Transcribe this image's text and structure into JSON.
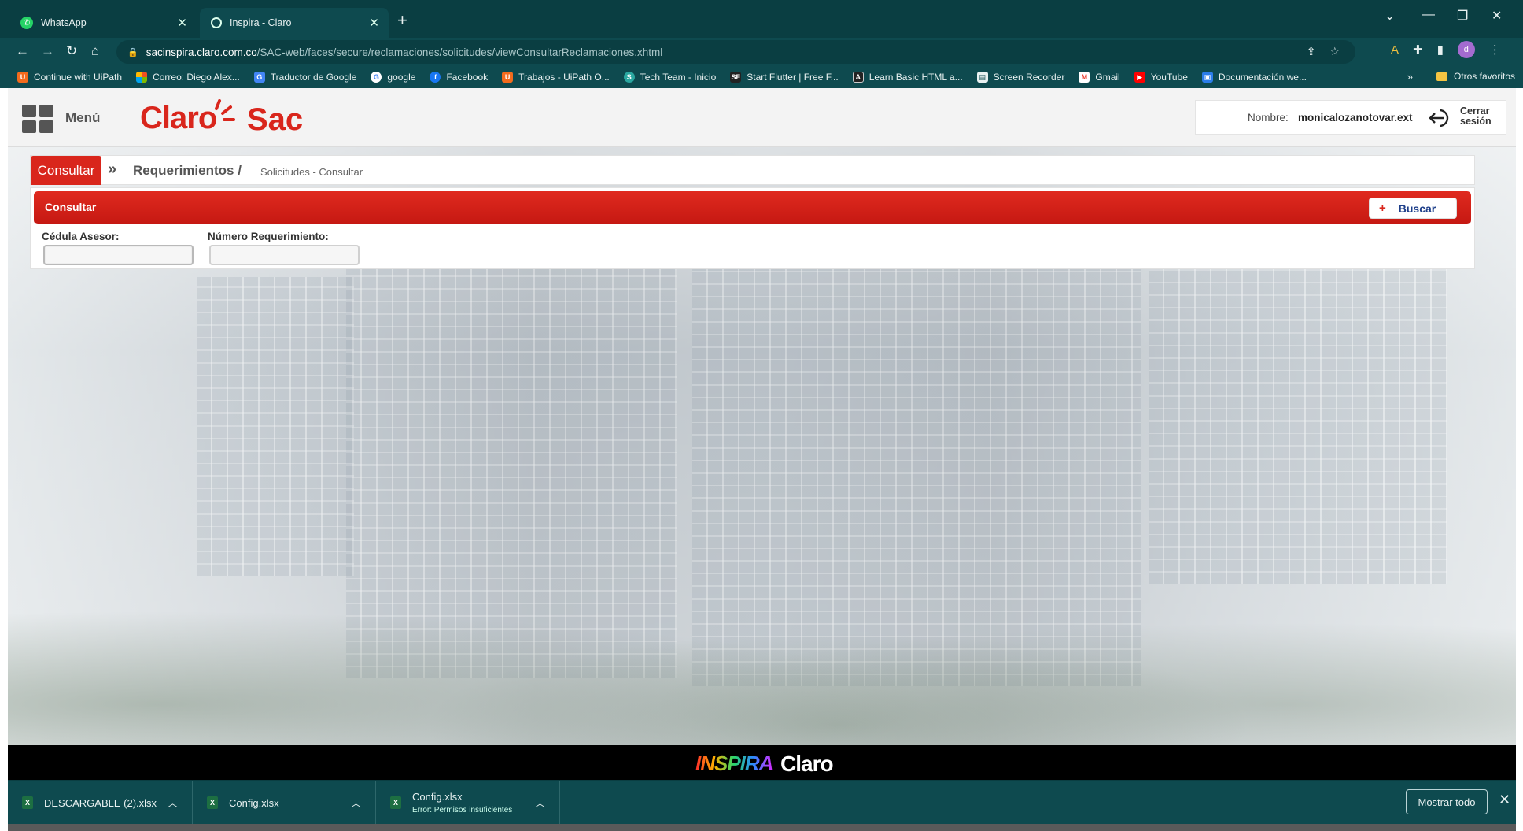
{
  "browser": {
    "tabs": [
      {
        "title": "WhatsApp",
        "icon": "whatsapp-icon"
      },
      {
        "title": "Inspira - Claro",
        "icon": "globe-icon"
      }
    ],
    "url_host": "sacinspira.claro.com.co",
    "url_path": "/SAC-web/faces/secure/reclamaciones/solicitudes/viewConsultarReclamaciones.xhtml",
    "profile_initial": "d",
    "bookmarks": [
      {
        "label": "Continue with UiPath",
        "icon": "uipath-icon",
        "color": "#f26b1d"
      },
      {
        "label": "Correo: Diego Alex...",
        "icon": "microsoft-icon",
        "color": "#f25022"
      },
      {
        "label": "Traductor de Google",
        "icon": "translate-icon",
        "color": "#4285f4"
      },
      {
        "label": "google",
        "icon": "google-icon",
        "color": "#ffffff"
      },
      {
        "label": "Facebook",
        "icon": "facebook-icon",
        "color": "#1877f2"
      },
      {
        "label": "Trabajos - UiPath O...",
        "icon": "uipath-icon",
        "color": "#f26b1d"
      },
      {
        "label": "Tech Team - Inicio",
        "icon": "techteam-icon",
        "color": "#2aa7a0"
      },
      {
        "label": "Start Flutter | Free F...",
        "icon": "sf-icon",
        "color": "#222222"
      },
      {
        "label": "Learn Basic HTML a...",
        "icon": "angular-icon",
        "color": "#222222"
      },
      {
        "label": "Screen Recorder",
        "icon": "document-icon",
        "color": "#e8f1f1"
      },
      {
        "label": "Gmail",
        "icon": "gmail-icon",
        "color": "#ea4335"
      },
      {
        "label": "YouTube",
        "icon": "youtube-icon",
        "color": "#ff0000"
      },
      {
        "label": "Documentación we...",
        "icon": "doc-web-icon",
        "color": "#2b7de9"
      }
    ],
    "bookmarks_more": "»",
    "other_bookmarks": "Otros favoritos"
  },
  "app": {
    "menu_label": "Menú",
    "logo_brand": "Claro",
    "logo_product": "Sac",
    "user_label": "Nombre:",
    "user_name": "monicalozanotovar.ext",
    "logout_label": "Cerrar sesión",
    "breadcrumb": {
      "button": "Consultar",
      "separator": "»",
      "main": "Requerimientos /",
      "sub": "Solicitudes - Consultar"
    },
    "panel": {
      "title": "Consultar",
      "search_button": "Buscar",
      "fields": [
        {
          "label": "Cédula Asesor:",
          "value": ""
        },
        {
          "label": "Número Requerimiento:",
          "value": ""
        }
      ]
    },
    "footer_brand_1": "INSPIRA",
    "footer_brand_2": "Claro",
    "accent_color": "#d9261c"
  },
  "downloads": {
    "items": [
      {
        "name": "DESCARGABLE (2).xlsx",
        "status": ""
      },
      {
        "name": "Config.xlsx",
        "status": ""
      },
      {
        "name": "Config.xlsx",
        "status": "Error: Permisos insuficientes"
      }
    ],
    "show_all": "Mostrar todo"
  }
}
